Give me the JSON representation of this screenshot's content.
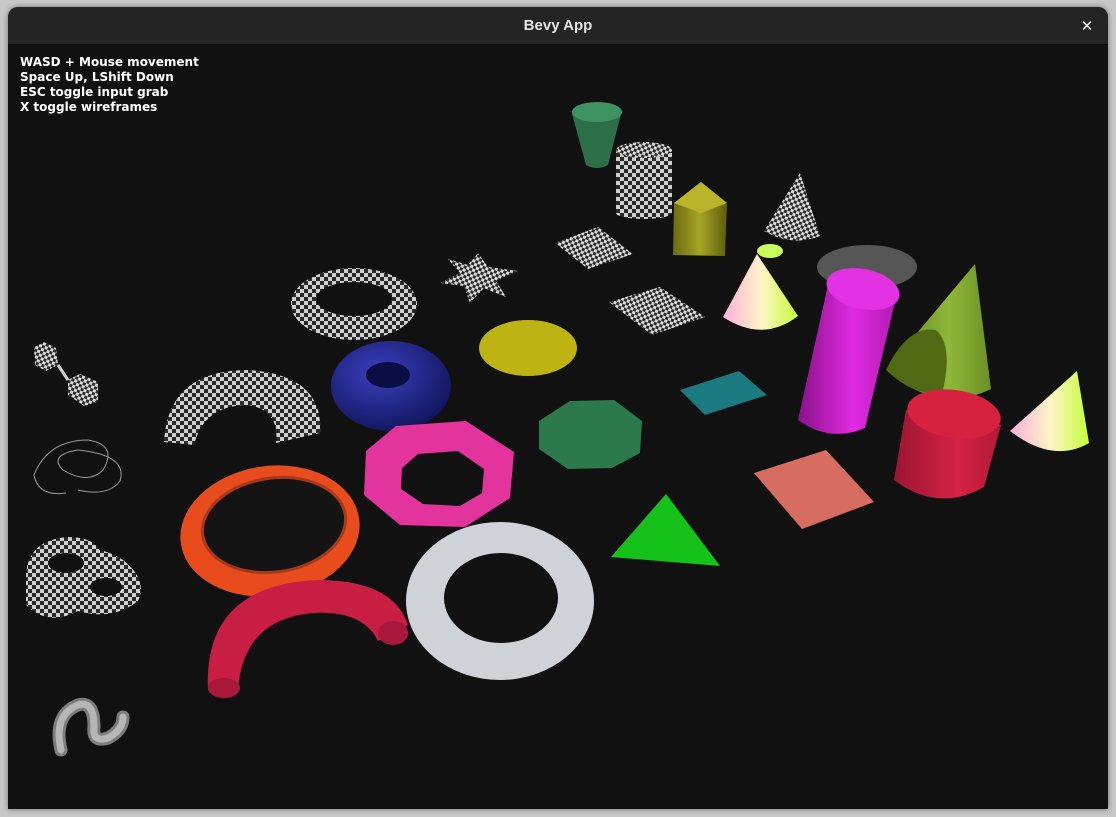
{
  "window": {
    "title": "Bevy App",
    "close_icon": "close-icon"
  },
  "help": {
    "lines": [
      "WASD + Mouse movement",
      "Space Up, LShift Down",
      "ESC toggle input grab",
      "X toggle wireframes"
    ]
  },
  "scene": {
    "background": "#111111",
    "objects": [
      {
        "name": "cylinder-green",
        "color": "#2e7d4f"
      },
      {
        "name": "cylinder-checker",
        "color": "#cfcfcf"
      },
      {
        "name": "prism-olive",
        "color": "#8a8a1c"
      },
      {
        "name": "cone-checker",
        "color": "#cfcfcf"
      },
      {
        "name": "plane-checker",
        "color": "#cfcfcf"
      },
      {
        "name": "star-checker",
        "color": "#cfcfcf"
      },
      {
        "name": "cone-gradient",
        "color": "#f0e6b0"
      },
      {
        "name": "disc-gray",
        "color": "#555555"
      },
      {
        "name": "torus-checker",
        "color": "#bdbdbd"
      },
      {
        "name": "plane-checker-2",
        "color": "#cfcfcf"
      },
      {
        "name": "cylinder-magenta",
        "color": "#d41fd4"
      },
      {
        "name": "cone-olive",
        "color": "#8ca032"
      },
      {
        "name": "circle-yellow",
        "color": "#bfb415"
      },
      {
        "name": "torus-blue",
        "color": "#20258a"
      },
      {
        "name": "rhombus-teal",
        "color": "#1a7c80"
      },
      {
        "name": "cylinder-red",
        "color": "#c41f3c"
      },
      {
        "name": "cone-gradient-2",
        "color": "#eee29a"
      },
      {
        "name": "octagon-green",
        "color": "#2b7a4b"
      },
      {
        "name": "octagon-torus-pink",
        "color": "#e0339a"
      },
      {
        "name": "rhombus-salmon",
        "color": "#d56c62"
      },
      {
        "name": "triangle-green",
        "color": "#14c21a"
      },
      {
        "name": "torus-orange",
        "color": "#e84a1e"
      },
      {
        "name": "torus-white",
        "color": "#c9ced4"
      },
      {
        "name": "half-torus-checker",
        "color": "#bdbdbd"
      },
      {
        "name": "half-torus-red",
        "color": "#c81e44"
      },
      {
        "name": "cube-pair-checker",
        "color": "#cfcfcf"
      },
      {
        "name": "knot-wireframe",
        "color": "#999999"
      },
      {
        "name": "knot-checker",
        "color": "#bdbdbd"
      },
      {
        "name": "s-curve-gray",
        "color": "#9d9d9d"
      }
    ]
  }
}
